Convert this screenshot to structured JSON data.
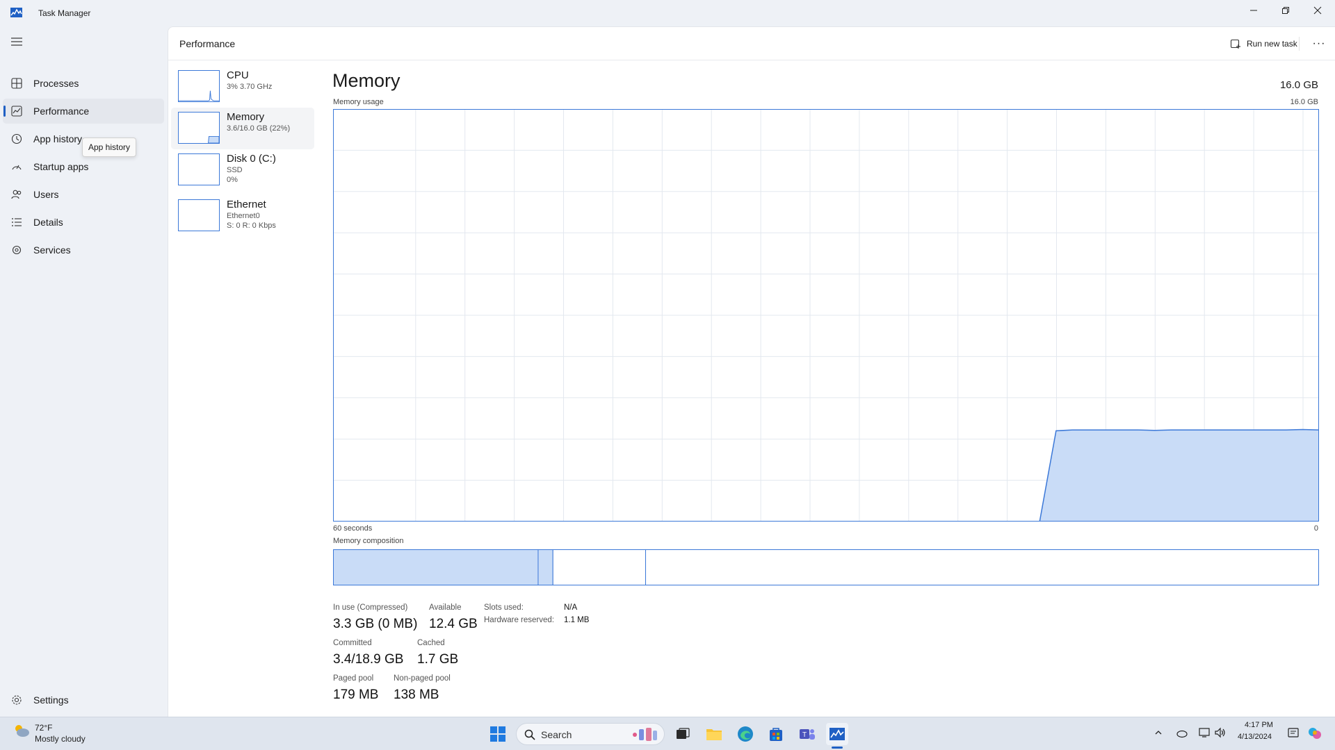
{
  "window": {
    "title": "Task Manager"
  },
  "nav": {
    "items": [
      {
        "label": "Processes",
        "icon": "processes-grid-icon"
      },
      {
        "label": "Performance",
        "icon": "performance-chart-icon",
        "active": true
      },
      {
        "label": "App history",
        "icon": "history-clock-icon"
      },
      {
        "label": "Startup apps",
        "icon": "startup-speedometer-icon"
      },
      {
        "label": "Users",
        "icon": "users-icon"
      },
      {
        "label": "Details",
        "icon": "details-list-icon"
      },
      {
        "label": "Services",
        "icon": "services-puzzle-icon"
      }
    ],
    "settings_label": "Settings",
    "tooltip": "App history"
  },
  "header": {
    "title": "Performance",
    "run_new_task": "Run new task",
    "more": "···"
  },
  "devices": [
    {
      "name": "CPU",
      "line1": "3% 3.70 GHz",
      "line2": ""
    },
    {
      "name": "Memory",
      "line1": "3.6/16.0 GB (22%)",
      "line2": "",
      "active": true
    },
    {
      "name": "Disk 0 (C:)",
      "line1": "SSD",
      "line2": "0%"
    },
    {
      "name": "Ethernet",
      "line1": "Ethernet0",
      "line2": "S: 0 R: 0 Kbps"
    }
  ],
  "memory": {
    "title": "Memory",
    "total": "16.0 GB",
    "usage_label": "Memory usage",
    "usage_max": "16.0 GB",
    "time_left": "60 seconds",
    "time_right": "0",
    "composition_label": "Memory composition",
    "usage_history_fraction": [
      0,
      0,
      0,
      0,
      0,
      0,
      0,
      0,
      0,
      0,
      0,
      0,
      0,
      0,
      0,
      0,
      0,
      0,
      0,
      0,
      0,
      0,
      0,
      0,
      0,
      0,
      0,
      0,
      0,
      0,
      0,
      0,
      0,
      0,
      0,
      0,
      0,
      0,
      0,
      0,
      0,
      0,
      0,
      0,
      0.22,
      0.222,
      0.222,
      0.222,
      0.222,
      0.222,
      0.221,
      0.222,
      0.222,
      0.222,
      0.222,
      0.222,
      0.222,
      0.222,
      0.222,
      0.223,
      0.222
    ],
    "composition": {
      "in_use_fraction": 0.208,
      "modified_fraction": 0.015,
      "standby_fraction": 0.094
    },
    "stats": {
      "in_use_label": "In use (Compressed)",
      "in_use_value": "3.3 GB (0 MB)",
      "available_label": "Available",
      "available_value": "12.4 GB",
      "slots_label": "Slots used:",
      "slots_value": "N/A",
      "hw_reserved_label": "Hardware reserved:",
      "hw_reserved_value": "1.1 MB",
      "committed_label": "Committed",
      "committed_value": "3.4/18.9 GB",
      "cached_label": "Cached",
      "cached_value": "1.7 GB",
      "paged_label": "Paged pool",
      "paged_value": "179 MB",
      "nonpaged_label": "Non-paged pool",
      "nonpaged_value": "138 MB"
    }
  },
  "colors": {
    "accent": "#1f60c4",
    "graph_line": "#3b78d8",
    "graph_fill": "#c9dcf7",
    "grid": "#e3e8ef"
  },
  "taskbar": {
    "weather_temp": "72°F",
    "weather_condition": "Mostly cloudy",
    "search_placeholder": "Search",
    "time": "4:17 PM",
    "date": "4/13/2024"
  }
}
